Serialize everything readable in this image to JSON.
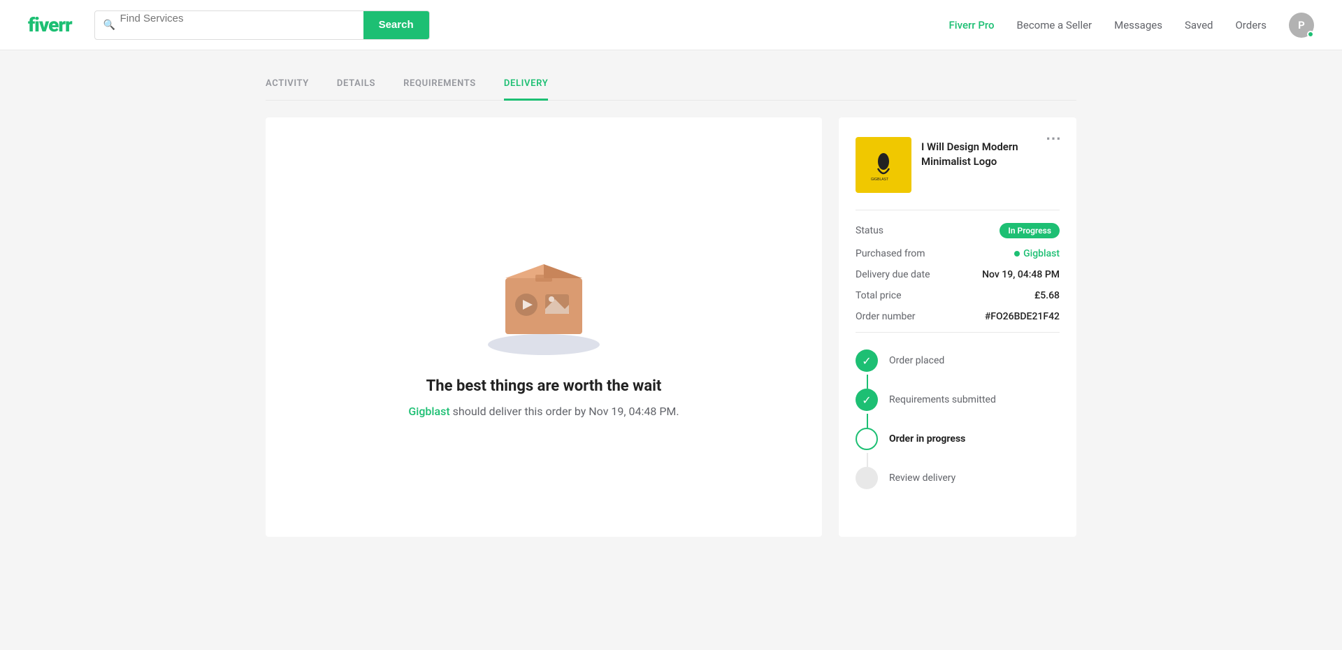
{
  "header": {
    "logo": "fiverr",
    "search": {
      "placeholder": "Find Services",
      "button_label": "Search"
    },
    "nav": {
      "pro": "Fiverr Pro",
      "become_seller": "Become a Seller",
      "messages": "Messages",
      "saved": "Saved",
      "orders": "Orders",
      "avatar_initial": "P"
    }
  },
  "tabs": [
    {
      "id": "activity",
      "label": "ACTIVITY",
      "active": false
    },
    {
      "id": "details",
      "label": "DETAILS",
      "active": false
    },
    {
      "id": "requirements",
      "label": "REQUIREMENTS",
      "active": false
    },
    {
      "id": "delivery",
      "label": "DELIVERY",
      "active": true
    }
  ],
  "delivery": {
    "title": "The best things are worth the wait",
    "seller_name": "Gigblast",
    "subtitle_text": " should deliver this order by Nov 19, 04:48 PM."
  },
  "order_sidebar": {
    "more_icon": "⋯",
    "gig_title": "I Will Design Modern Minimalist Logo",
    "status_label": "Status",
    "status_value": "In Progress",
    "purchased_from_label": "Purchased from",
    "purchased_from_value": "Gigblast",
    "delivery_due_label": "Delivery due date",
    "delivery_due_value": "Nov 19, 04:48 PM",
    "total_price_label": "Total price",
    "total_price_value": "£5.68",
    "order_number_label": "Order number",
    "order_number_value": "#FO26BDE21F42",
    "tracker_items": [
      {
        "id": "placed",
        "label": "Order placed",
        "state": "completed"
      },
      {
        "id": "requirements",
        "label": "Requirements submitted",
        "state": "completed"
      },
      {
        "id": "in_progress",
        "label": "Order in progress",
        "state": "current"
      },
      {
        "id": "review",
        "label": "Review delivery",
        "state": "pending"
      }
    ]
  }
}
